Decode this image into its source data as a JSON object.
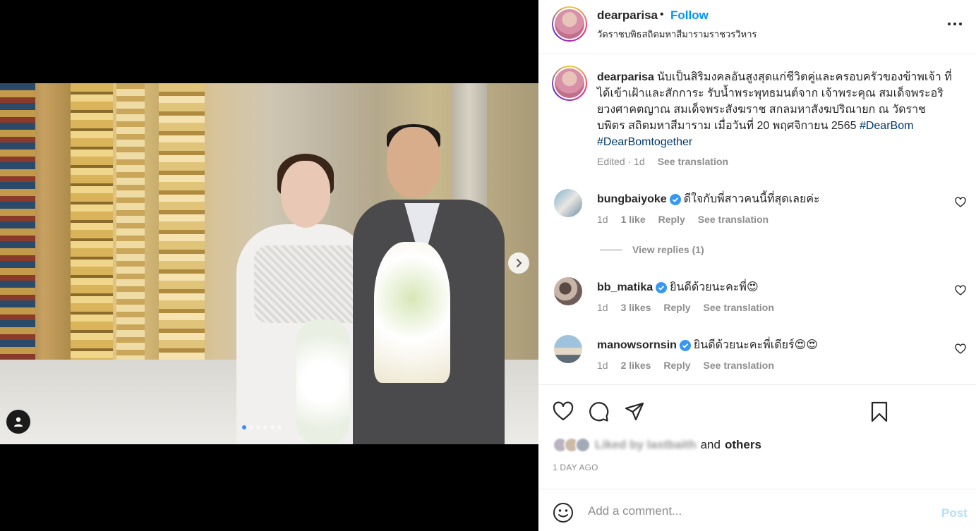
{
  "post": {
    "username": "dearparisa",
    "separator": "•",
    "follow_label": "Follow",
    "location": "วัดราชบพิธสถิตมหาสีมารามราชวรวิหาร"
  },
  "caption": {
    "username": "dearparisa",
    "text": "นับเป็นสิริมงคลอันสูงสุดแก่ชีวิตคู่และครอบครัวของข้าพเจ้า ที่ได้เข้าเฝ้าและสักการะ รับน้ำพระพุทธมนต์จาก เจ้าพระคุณ สมเด็จพระอริยวงศาคตญาณ สมเด็จพระสังฆราช สกลมหาสังฆปริณายก ณ วัดราชบพิตร สถิตมหาสีมาราม เมื่อวันที่ 20 พฤศจิกายน 2565",
    "hashtag1": "#DearBom",
    "hashtag2": "#DearBomtogether",
    "edited": "Edited · 1d",
    "see_translation": "See translation"
  },
  "comments": [
    {
      "username": "bungbaiyoke",
      "text": "ดีใจกับพี่สาวคนนี้ที่สุดเลยค่ะ",
      "time": "1d",
      "likes": "1 like",
      "reply": "Reply",
      "see_translation": "See translation"
    },
    {
      "username": "bb_matika",
      "text": "ยินดีด้วยนะคะพี่😍",
      "time": "1d",
      "likes": "3 likes",
      "reply": "Reply",
      "see_translation": "See translation"
    },
    {
      "username": "manowsornsin",
      "text": "ยินดีด้วยนะคะพี่เดียร์😍😍",
      "time": "1d",
      "likes": "2 likes",
      "reply": "Reply",
      "see_translation": "See translation"
    }
  ],
  "view_replies": "View replies (1)",
  "likes": {
    "blurred": "Liked by lastbaith",
    "and": "and",
    "others": "others"
  },
  "posted_ago": "1 DAY AGO",
  "add_comment": {
    "placeholder": "Add a comment...",
    "post_label": "Post"
  },
  "carousel": {
    "slide_count": 6,
    "active_index": 0
  },
  "colors": {
    "accent": "#0095f6",
    "verified": "#3897f0",
    "post_disabled": "#b2dffc"
  },
  "icons": [
    "more-icon",
    "heart-icon",
    "comment-icon",
    "share-icon",
    "bookmark-icon",
    "emoji-icon",
    "verified-icon",
    "chevron-right-icon",
    "user-tag-icon"
  ]
}
